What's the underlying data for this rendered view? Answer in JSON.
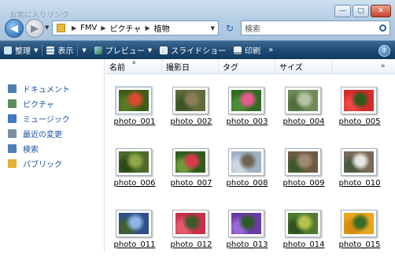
{
  "address": {
    "crumbs": [
      "FMV",
      "ピクチャ",
      "植物"
    ]
  },
  "search": {
    "placeholder": "検索"
  },
  "commands": {
    "organize": "整理",
    "views": "表示",
    "preview": "プレビュー",
    "slideshow": "スライドショー",
    "print": "印刷",
    "more": "»"
  },
  "sidebar": {
    "heading": "お気に入りリンク",
    "items": [
      {
        "label": "ドキュメント",
        "icon": "document-icon",
        "color": "#4f7fb5"
      },
      {
        "label": "ピクチャ",
        "icon": "pictures-icon",
        "color": "#5b8e5d"
      },
      {
        "label": "ミュージック",
        "icon": "music-icon",
        "color": "#3f78c4"
      },
      {
        "label": "最近の変更",
        "icon": "recent-icon",
        "color": "#7a8ea3"
      },
      {
        "label": "検索",
        "icon": "search-folder-icon",
        "color": "#4f7fb5"
      },
      {
        "label": "パブリック",
        "icon": "public-folder-icon",
        "color": "#e2b23a"
      }
    ]
  },
  "columns": [
    "名前",
    "撮影日",
    "タグ",
    "サイズ"
  ],
  "column_more": "»",
  "photos": [
    {
      "name": "photo_001",
      "colors": [
        "#3d5d1a",
        "#d94b2e",
        "#557a27"
      ]
    },
    {
      "name": "photo_002",
      "colors": [
        "#5d6b3a",
        "#8c7d55",
        "#3d5226"
      ]
    },
    {
      "name": "photo_003",
      "colors": [
        "#2f6b23",
        "#e65a8c",
        "#4e8d38"
      ]
    },
    {
      "name": "photo_004",
      "colors": [
        "#6e8a55",
        "#b8c2a8",
        "#4f6e3a"
      ]
    },
    {
      "name": "photo_005",
      "colors": [
        "#d42a2a",
        "#2f5a1c",
        "#f04646"
      ]
    },
    {
      "name": "photo_006",
      "colors": [
        "#4d6b2c",
        "#8fa64a",
        "#2c4a18"
      ]
    },
    {
      "name": "photo_007",
      "colors": [
        "#325a1d",
        "#d83a4a",
        "#6e9b3a"
      ]
    },
    {
      "name": "photo_008",
      "colors": [
        "#9fb2c6",
        "#6e6452",
        "#cfd8e0"
      ]
    },
    {
      "name": "photo_009",
      "colors": [
        "#6f5a44",
        "#a08a70",
        "#3e5a2a"
      ]
    },
    {
      "name": "photo_010",
      "colors": [
        "#7a6a5a",
        "#e8e6e0",
        "#4a5a3a"
      ]
    },
    {
      "name": "photo_011",
      "colors": [
        "#2e4f8a",
        "#8fb4e6",
        "#43602e"
      ]
    },
    {
      "name": "photo_012",
      "colors": [
        "#c9304a",
        "#3d5a2a",
        "#e65a6e"
      ]
    },
    {
      "name": "photo_013",
      "colors": [
        "#6a3aa6",
        "#2f5a2a",
        "#9a6ad6"
      ]
    },
    {
      "name": "photo_014",
      "colors": [
        "#4f7a30",
        "#b4c44a",
        "#2e5220"
      ]
    },
    {
      "name": "photo_015",
      "colors": [
        "#e6a61e",
        "#3a6b24",
        "#d88a14"
      ]
    }
  ]
}
